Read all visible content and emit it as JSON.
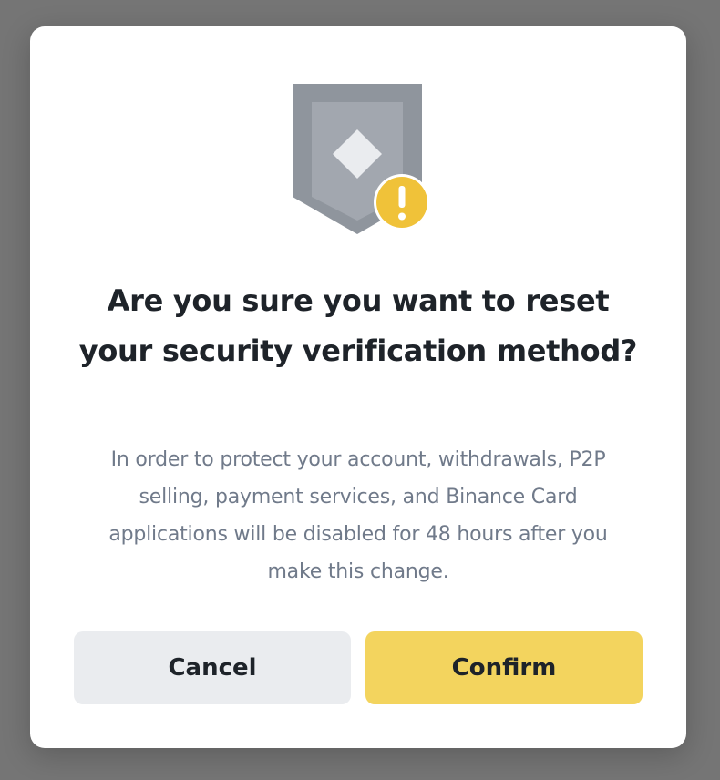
{
  "dialog": {
    "title": "Are you sure you want to reset your security verification method?",
    "message": "In order to protect your account, withdrawals, P2P selling, payment services, and Binance Card applications will be disabled for 48 hours after you make this change.",
    "cancel_label": "Cancel",
    "confirm_label": "Confirm",
    "icons": {
      "shield": "shield-icon",
      "warning": "warning-icon"
    }
  },
  "colors": {
    "overlay": "#757575",
    "dialog_background": "#ffffff",
    "title_text": "#1e2329",
    "body_text": "#707a8a",
    "cancel_button": "#eaecef",
    "confirm_button": "#f3d45e",
    "warning_badge": "#f0c239",
    "shield": "#9aa0a8"
  }
}
